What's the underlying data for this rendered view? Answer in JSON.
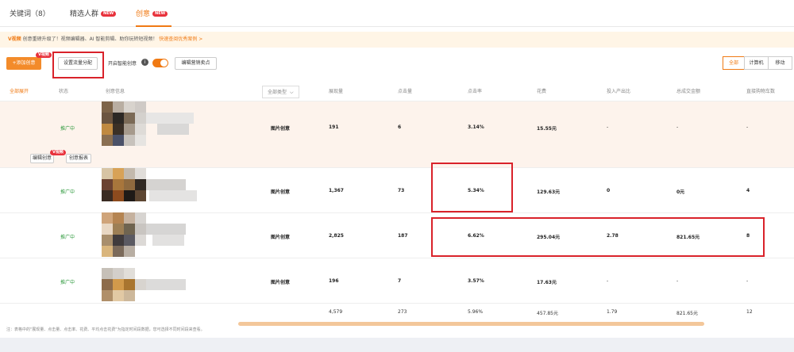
{
  "tabs": [
    {
      "label": "关键词（8）",
      "badge": ""
    },
    {
      "label": "精选人群",
      "badge": "NEW"
    },
    {
      "label": "创意",
      "badge": "NEW"
    }
  ],
  "notice": {
    "prefix": "V视频",
    "text": "创意重磅升级了！视频编辑器、AI 智能剪辑、助你玩转短视频！",
    "link": "快速查阅优秀案例 >"
  },
  "toolbar": {
    "add_label": "+添加创意",
    "traffic_label": "设置流量分配",
    "smart_label": "开启智能创意",
    "marketing_label": "编辑营销卖点",
    "vip_badge": "V视频",
    "segments": [
      "全部",
      "计算机",
      "移动"
    ]
  },
  "table": {
    "headers": [
      "全部展开",
      "状态",
      "创意信息",
      "全部类型",
      "展现量",
      "点击量",
      "点击率",
      "花费",
      "投入产出比",
      "总成交金额",
      "直接购物车数"
    ],
    "rows": [
      {
        "status": "推广中",
        "type": "图片创意",
        "impressions": "191",
        "clicks": "6",
        "ctr": "3.14%",
        "cost": "15.55元",
        "roi": "-",
        "gmv": "-",
        "cart": "-"
      },
      {
        "status": "推广中",
        "type": "图片创意",
        "impressions": "1,367",
        "clicks": "73",
        "ctr": "5.34%",
        "cost": "129.63元",
        "roi": "0",
        "gmv": "0元",
        "cart": "4"
      },
      {
        "status": "推广中",
        "type": "图片创意",
        "impressions": "2,825",
        "clicks": "187",
        "ctr": "6.62%",
        "cost": "295.04元",
        "roi": "2.78",
        "gmv": "821.65元",
        "cart": "8"
      },
      {
        "status": "推广中",
        "type": "图片创意",
        "impressions": "196",
        "clicks": "7",
        "ctr": "3.57%",
        "cost": "17.63元",
        "roi": "-",
        "gmv": "-",
        "cart": "-"
      }
    ],
    "row_actions": {
      "edit": "编辑创意",
      "report": "创意报表"
    },
    "totals": {
      "impressions": "4,579",
      "clicks": "273",
      "ctr": "5.96%",
      "cost": "457.85元",
      "roi": "1.79",
      "gmv": "821.65元",
      "cart": "12"
    }
  },
  "footnote": "注：表格中的\"展现量、点击量、点击率、花费、平均点击花费\"为指定时间段数据，您可选择不同时间段来查看。",
  "colors": {
    "accent": "#f07a14",
    "status_green": "#2f9a3e",
    "highlight_red": "#d9222a"
  }
}
